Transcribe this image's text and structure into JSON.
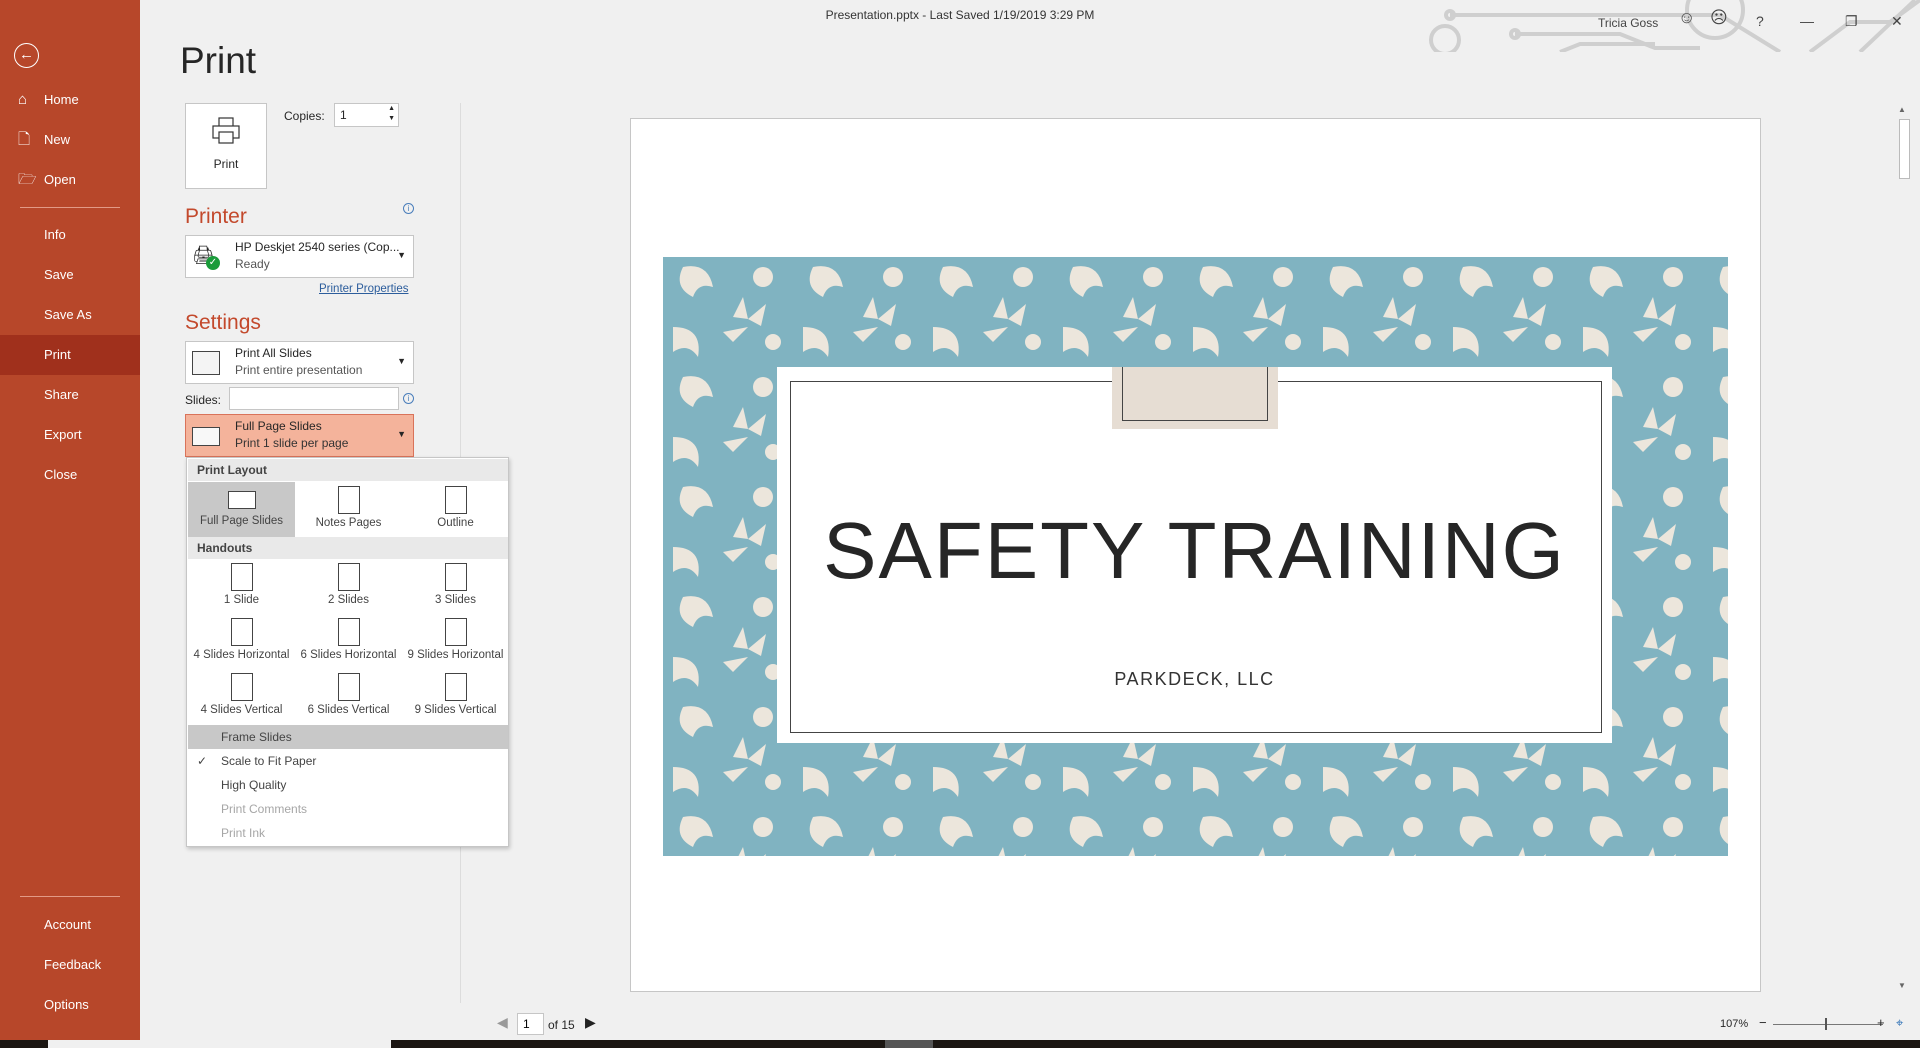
{
  "window": {
    "title": "Presentation.pptx  -  Last Saved 1/19/2019 3:29 PM",
    "user": "Tricia Goss",
    "help": "?"
  },
  "sidebar": {
    "items": [
      {
        "label": "Home",
        "icon": "home-icon"
      },
      {
        "label": "New",
        "icon": "new-document-icon"
      },
      {
        "label": "Open",
        "icon": "folder-open-icon"
      },
      {
        "label": "Info"
      },
      {
        "label": "Save"
      },
      {
        "label": "Save As"
      },
      {
        "label": "Print",
        "active": true
      },
      {
        "label": "Share"
      },
      {
        "label": "Export"
      },
      {
        "label": "Close"
      }
    ],
    "bottom": [
      {
        "label": "Account"
      },
      {
        "label": "Feedback"
      },
      {
        "label": "Options"
      }
    ]
  },
  "print": {
    "title": "Print",
    "button": "Print",
    "copies_label": "Copies:",
    "copies": "1"
  },
  "printer": {
    "heading": "Printer",
    "name": "HP Deskjet 2540 series (Cop...",
    "status": "Ready",
    "properties": "Printer Properties"
  },
  "settings": {
    "heading": "Settings",
    "range_title": "Print All Slides",
    "range_sub": "Print entire presentation",
    "slides_label": "Slides:",
    "slides_value": "",
    "layout_title": "Full Page Slides",
    "layout_sub": "Print 1 slide per page"
  },
  "menu": {
    "print_layout": "Print Layout",
    "layouts": [
      "Full Page Slides",
      "Notes Pages",
      "Outline"
    ],
    "handouts": "Handouts",
    "handout_options": [
      "1 Slide",
      "2 Slides",
      "3 Slides",
      "4 Slides Horizontal",
      "6 Slides Horizontal",
      "9 Slides Horizontal",
      "4 Slides Vertical",
      "6 Slides Vertical",
      "9 Slides Vertical"
    ],
    "items": [
      {
        "label": "Frame Slides",
        "checked": false,
        "enabled": true
      },
      {
        "label": "Scale to Fit Paper",
        "checked": true,
        "enabled": true
      },
      {
        "label": "High Quality",
        "checked": false,
        "enabled": true
      },
      {
        "label": "Print Comments",
        "checked": false,
        "enabled": false
      },
      {
        "label": "Print Ink",
        "checked": false,
        "enabled": false
      }
    ]
  },
  "slide": {
    "title": "SAFETY TRAINING",
    "subtitle": "PARKDECK, LLC"
  },
  "pager": {
    "page": "1",
    "of": "of 15"
  },
  "zoom": {
    "level": "107%",
    "minus": "−",
    "plus": "+"
  },
  "colors": {
    "accent": "#b7472a",
    "active": "#a0301c",
    "slide_bg": "#80b3c1",
    "pattern": "#ece6dc"
  }
}
